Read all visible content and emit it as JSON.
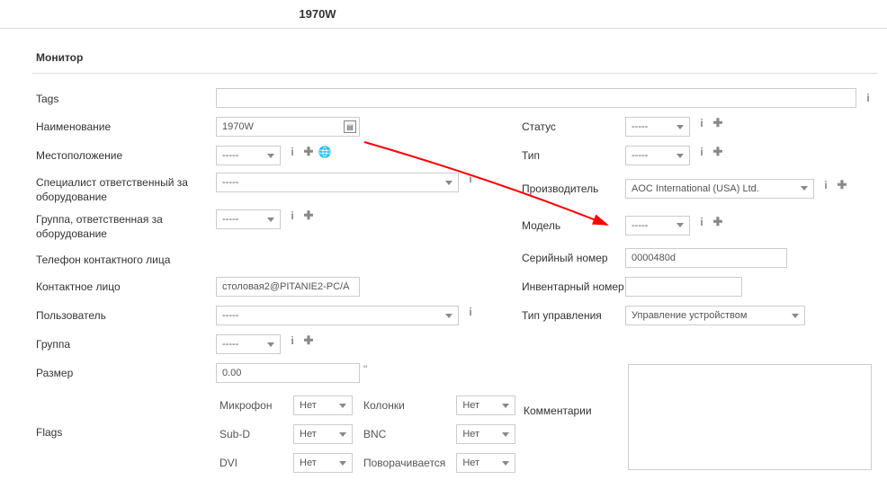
{
  "title": "1970W",
  "section_title": "Монитор",
  "labels": {
    "tags": "Tags",
    "name": "Наименование",
    "location": "Местоположение",
    "tech_spec": "Специалист ответственный за оборудование",
    "tech_group": "Группа, ответственная за оборудование",
    "contact_phone": "Телефон контактного лица",
    "contact": "Контактное лицо",
    "user": "Пользователь",
    "group": "Группа",
    "size": "Размер",
    "flags": "Flags",
    "status": "Статус",
    "type": "Тип",
    "manufacturer": "Производитель",
    "model": "Модель",
    "serial": "Серийный номер",
    "inventory": "Инвентарный номер",
    "mgmt": "Тип управления",
    "comments": "Комментарии",
    "mic": "Микрофон",
    "speakers": "Колонки",
    "subd": "Sub-D",
    "bnc": "BNC",
    "dvi": "DVI",
    "pivot": "Поворачивается"
  },
  "values": {
    "tags": "",
    "name": "1970W",
    "contact": "столовая2@PITANIE2-PC/À",
    "size": "0.00",
    "serial": "0000480d",
    "inventory": "",
    "manufacturer": "AOC International (USA) Ltd.",
    "mgmt": "Управление устройством"
  },
  "placeholders": {
    "dash": "-----",
    "no": "Нет"
  },
  "suffix": {
    "inch": "\""
  }
}
